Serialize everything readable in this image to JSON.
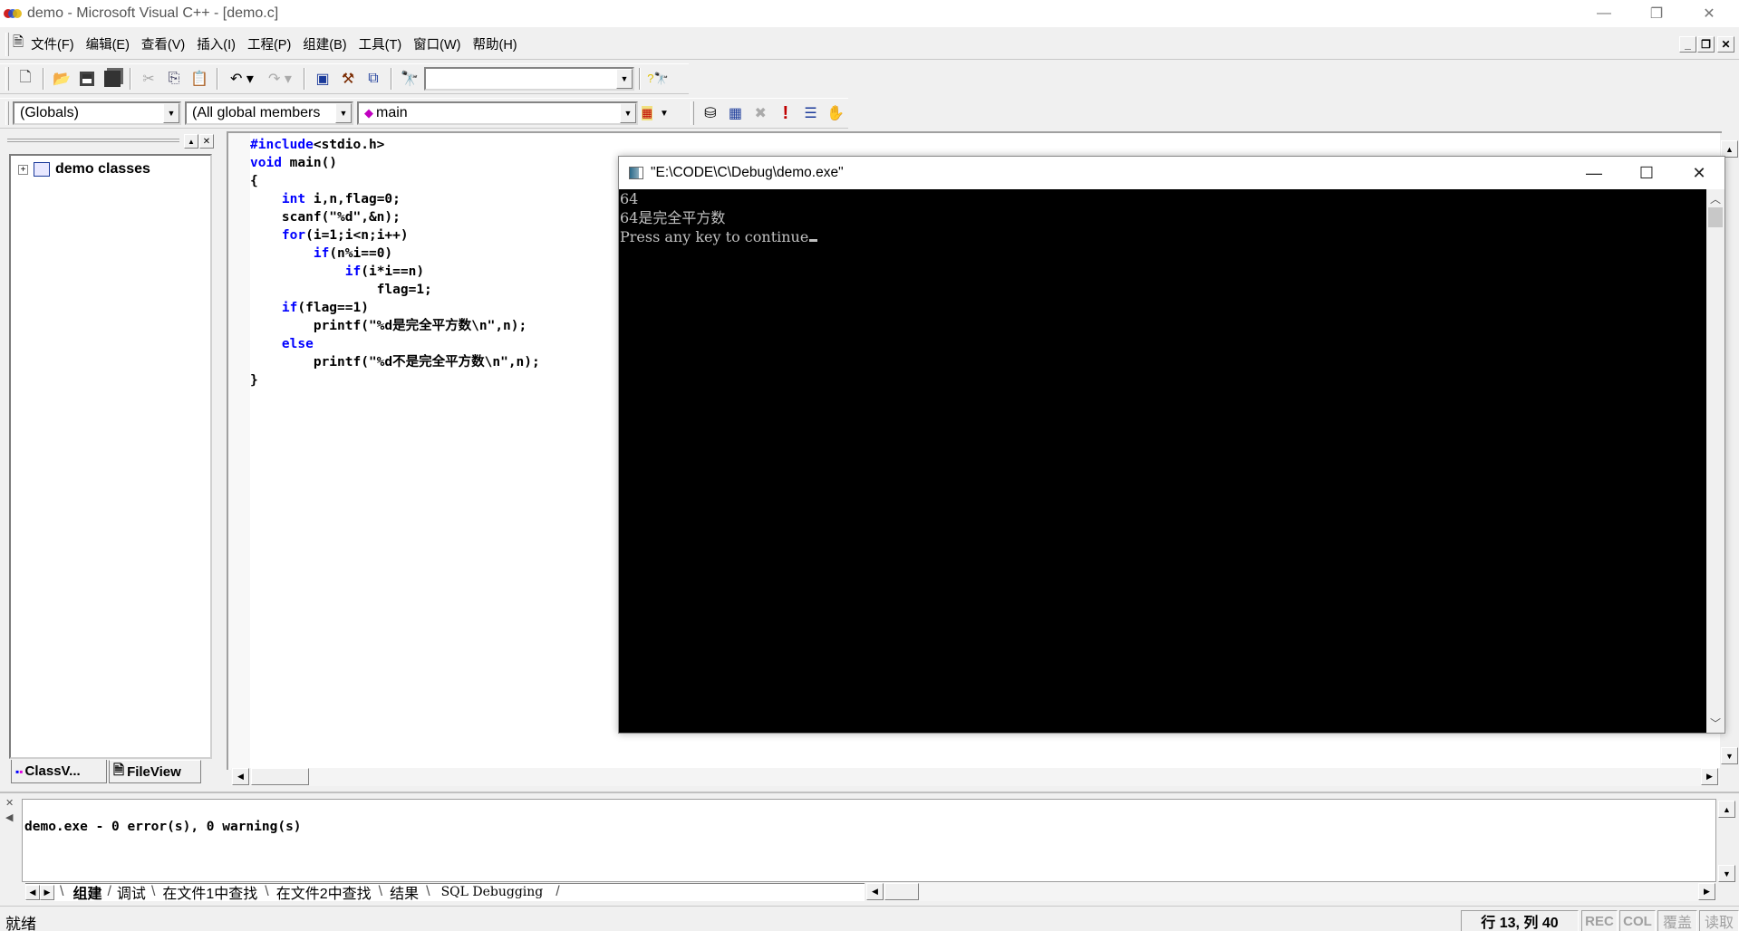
{
  "window": {
    "title": "demo - Microsoft Visual C++ - [demo.c]"
  },
  "menu": {
    "items": [
      {
        "label": "文件(F)"
      },
      {
        "label": "编辑(E)"
      },
      {
        "label": "查看(V)"
      },
      {
        "label": "插入(I)"
      },
      {
        "label": "工程(P)"
      },
      {
        "label": "组建(B)"
      },
      {
        "label": "工具(T)"
      },
      {
        "label": "窗口(W)"
      },
      {
        "label": "帮助(H)"
      }
    ]
  },
  "toolbar": {
    "find_combo_value": "",
    "icons": [
      "new-text-file",
      "open",
      "save",
      "save-all",
      "cut",
      "copy",
      "paste",
      "undo",
      "redo",
      "workspace",
      "output",
      "window-list",
      "find-in-files",
      "search-help"
    ]
  },
  "wizardbar": {
    "class_combo": "(Globals)",
    "filter_combo": "(All global members",
    "members_combo": "main"
  },
  "workspace": {
    "tree_root": "demo classes",
    "tabs": [
      {
        "label": "ClassV..."
      },
      {
        "label": "FileView"
      }
    ]
  },
  "editor": {
    "lines": [
      [
        {
          "t": "#include",
          "k": 1
        },
        {
          "t": "<stdio.h>"
        }
      ],
      [
        {
          "t": "void",
          "k": 1
        },
        {
          "t": " main()"
        }
      ],
      [
        {
          "t": "{"
        }
      ],
      [
        {
          "t": "    "
        },
        {
          "t": "int",
          "k": 1
        },
        {
          "t": " i,n,flag=0;"
        }
      ],
      [
        {
          "t": "    scanf(\"%d\",&n);"
        }
      ],
      [
        {
          "t": "    "
        },
        {
          "t": "for",
          "k": 1
        },
        {
          "t": "(i=1;i<n;i++)"
        }
      ],
      [
        {
          "t": "        "
        },
        {
          "t": "if",
          "k": 1
        },
        {
          "t": "(n%i==0)"
        }
      ],
      [
        {
          "t": "            "
        },
        {
          "t": "if",
          "k": 1
        },
        {
          "t": "(i*i==n)"
        }
      ],
      [
        {
          "t": "                flag=1;"
        }
      ],
      [
        {
          "t": "    "
        },
        {
          "t": "if",
          "k": 1
        },
        {
          "t": "(flag==1)"
        }
      ],
      [
        {
          "t": "        printf(\"%d是完全平方数\\n\",n);"
        }
      ],
      [
        {
          "t": "    "
        },
        {
          "t": "else",
          "k": 1
        }
      ],
      [
        {
          "t": "        printf(\"%d不是完全平方数\\n\",n);"
        }
      ],
      [
        {
          "t": "}"
        }
      ]
    ]
  },
  "console": {
    "title": "\"E:\\CODE\\C\\Debug\\demo.exe\"",
    "lines": [
      "64",
      "64是完全平方数",
      "Press any key to continue"
    ]
  },
  "output": {
    "text": "demo.exe - 0 error(s), 0 warning(s)",
    "tabs": [
      {
        "label": "组建",
        "active": true
      },
      {
        "label": "调试"
      },
      {
        "label": "在文件1中查找"
      },
      {
        "label": "在文件2中查找"
      },
      {
        "label": "结果"
      },
      {
        "label": "SQL Debugging"
      }
    ]
  },
  "status": {
    "message": "就绪",
    "position": "行 13, 列 40",
    "indicators": [
      "REC",
      "COL",
      "覆盖",
      "读取"
    ]
  }
}
